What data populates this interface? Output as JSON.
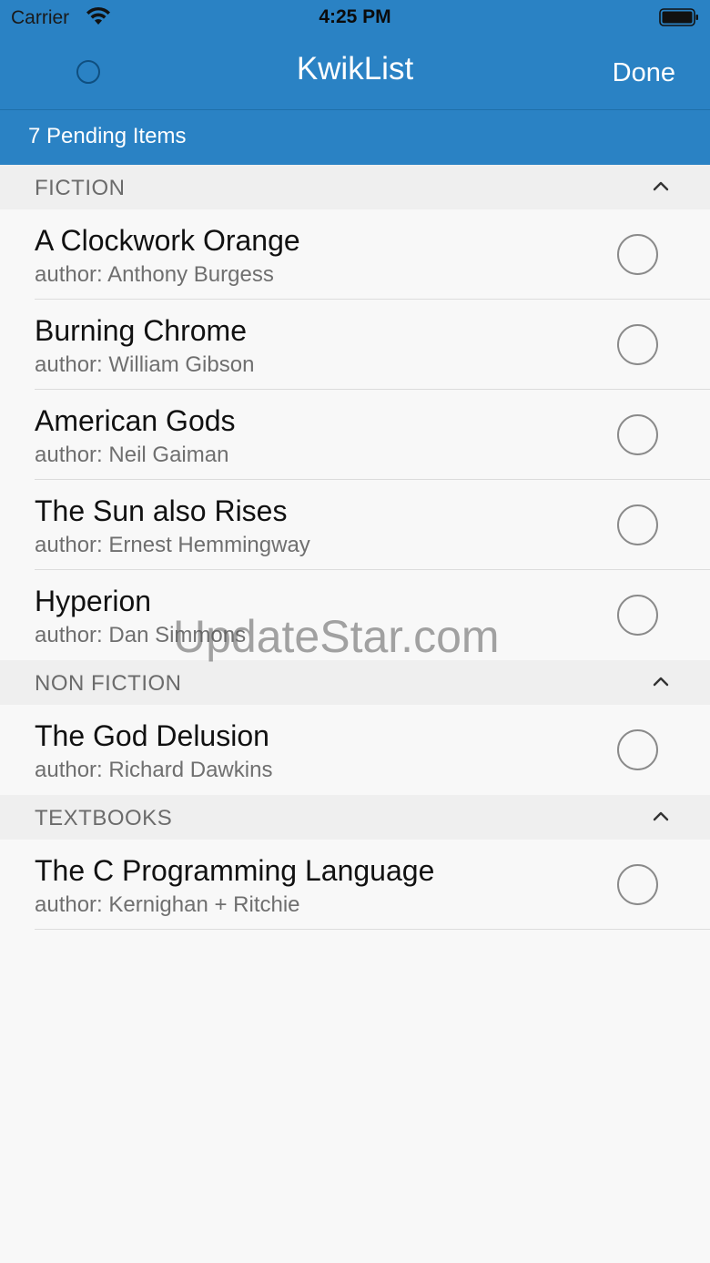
{
  "status_bar": {
    "carrier": "Carrier",
    "time": "4:25 PM",
    "wifi_icon": "wifi-icon",
    "battery_icon": "battery-full-icon"
  },
  "nav": {
    "title": "KwikList",
    "done_label": "Done",
    "left_icon": "circle-outline-icon"
  },
  "pending": {
    "label": "7 Pending Items"
  },
  "sections": [
    {
      "title": "FICTION",
      "items": [
        {
          "title": "A Clockwork Orange",
          "subtitle": "author: Anthony Burgess"
        },
        {
          "title": "Burning Chrome",
          "subtitle": "author: William Gibson"
        },
        {
          "title": "American Gods",
          "subtitle": "author: Neil Gaiman"
        },
        {
          "title": "The Sun also Rises",
          "subtitle": "author: Ernest Hemmingway"
        },
        {
          "title": "Hyperion",
          "subtitle": "author: Dan Simmons"
        }
      ]
    },
    {
      "title": "NON FICTION",
      "items": [
        {
          "title": "The God Delusion",
          "subtitle": "author: Richard Dawkins"
        }
      ]
    },
    {
      "title": "TEXTBOOKS",
      "items": [
        {
          "title": "The C Programming Language",
          "subtitle": "author: Kernighan + Ritchie"
        }
      ]
    }
  ],
  "watermark": "UpdateStar.com",
  "colors": {
    "accent": "#2a82c4",
    "background": "#f8f8f8",
    "section_header": "#efefef"
  }
}
